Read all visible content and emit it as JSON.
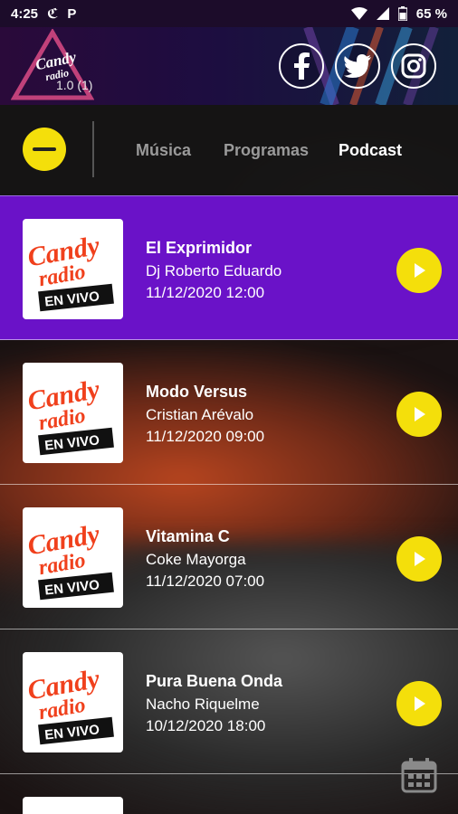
{
  "status_bar": {
    "time": "4:25",
    "battery": "65 %",
    "icons": [
      "claro-icon",
      "p-icon",
      "wifi-icon",
      "signal-icon",
      "battery-icon"
    ]
  },
  "header": {
    "logo_text": "Candy radio",
    "version": "1.0 (1)",
    "social": [
      "facebook-icon",
      "twitter-icon",
      "instagram-icon"
    ]
  },
  "nav": {
    "tabs": [
      {
        "label": "Música"
      },
      {
        "label": "Programas"
      },
      {
        "label": "Podcast"
      }
    ],
    "active_tab": "Podcast"
  },
  "items": [
    {
      "title": "El Exprimidor",
      "host": "Dj Roberto Eduardo",
      "date": "11/12/2020 12:00"
    },
    {
      "title": "Modo Versus",
      "host": "Cristian Arévalo",
      "date": "11/12/2020 09:00"
    },
    {
      "title": "Vitamina C",
      "host": "Coke Mayorga",
      "date": "11/12/2020 07:00"
    },
    {
      "title": "Pura Buena Onda",
      "host": "Nacho Riquelme",
      "date": "10/12/2020 18:00"
    }
  ],
  "thumb": {
    "line1": "Candy",
    "line2": "radio",
    "badge": "EN VIVO"
  },
  "colors": {
    "accent": "#f4df0b",
    "highlight_row": "#6a12c8",
    "brand_orange": "#f0401c"
  }
}
